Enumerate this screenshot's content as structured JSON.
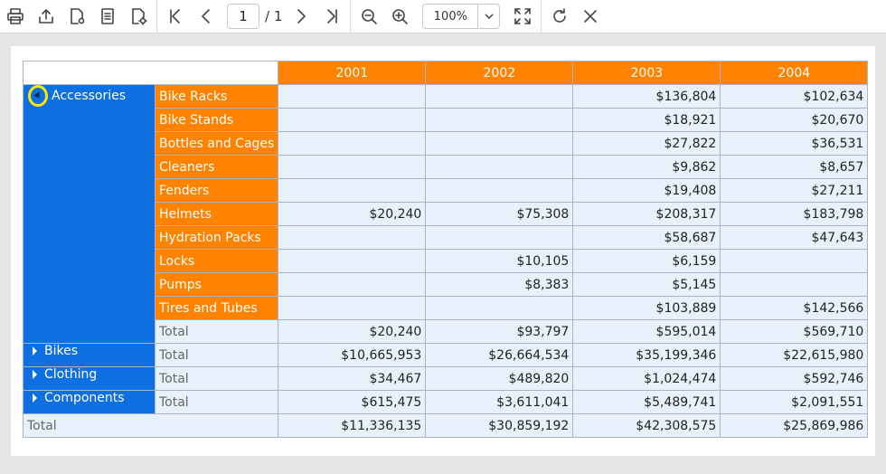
{
  "toolbar": {
    "current_page": "1",
    "page_total": "/ 1",
    "zoom": "100%"
  },
  "pivot": {
    "years": [
      "2001",
      "2002",
      "2003",
      "2004"
    ],
    "accessories": {
      "label": "Accessories",
      "rows": [
        {
          "name": "Bike Racks",
          "values": [
            "",
            "",
            "$136,804",
            "$102,634"
          ]
        },
        {
          "name": "Bike Stands",
          "values": [
            "",
            "",
            "$18,921",
            "$20,670"
          ]
        },
        {
          "name": "Bottles and Cages",
          "values": [
            "",
            "",
            "$27,822",
            "$36,531"
          ]
        },
        {
          "name": "Cleaners",
          "values": [
            "",
            "",
            "$9,862",
            "$8,657"
          ]
        },
        {
          "name": "Fenders",
          "values": [
            "",
            "",
            "$19,408",
            "$27,211"
          ]
        },
        {
          "name": "Helmets",
          "values": [
            "$20,240",
            "$75,308",
            "$208,317",
            "$183,798"
          ]
        },
        {
          "name": "Hydration Packs",
          "values": [
            "",
            "",
            "$58,687",
            "$47,643"
          ]
        },
        {
          "name": "Locks",
          "values": [
            "",
            "$10,105",
            "$6,159",
            ""
          ]
        },
        {
          "name": "Pumps",
          "values": [
            "",
            "$8,383",
            "$5,145",
            ""
          ]
        },
        {
          "name": "Tires and Tubes",
          "values": [
            "",
            "",
            "$103,889",
            "$142,566"
          ]
        }
      ],
      "total_label": "Total",
      "total": [
        "$20,240",
        "$93,797",
        "$595,014",
        "$569,710"
      ]
    },
    "collapsed": [
      {
        "label": "Bikes",
        "total_label": "Total",
        "values": [
          "$10,665,953",
          "$26,664,534",
          "$35,199,346",
          "$22,615,980"
        ]
      },
      {
        "label": "Clothing",
        "total_label": "Total",
        "values": [
          "$34,467",
          "$489,820",
          "$1,024,474",
          "$592,746"
        ]
      },
      {
        "label": "Components",
        "total_label": "Total",
        "values": [
          "$615,475",
          "$3,611,041",
          "$5,489,741",
          "$2,091,551"
        ]
      }
    ],
    "grand_total": {
      "label": "Total",
      "values": [
        "$11,336,135",
        "$30,859,192",
        "$42,308,575",
        "$25,869,986"
      ]
    }
  }
}
